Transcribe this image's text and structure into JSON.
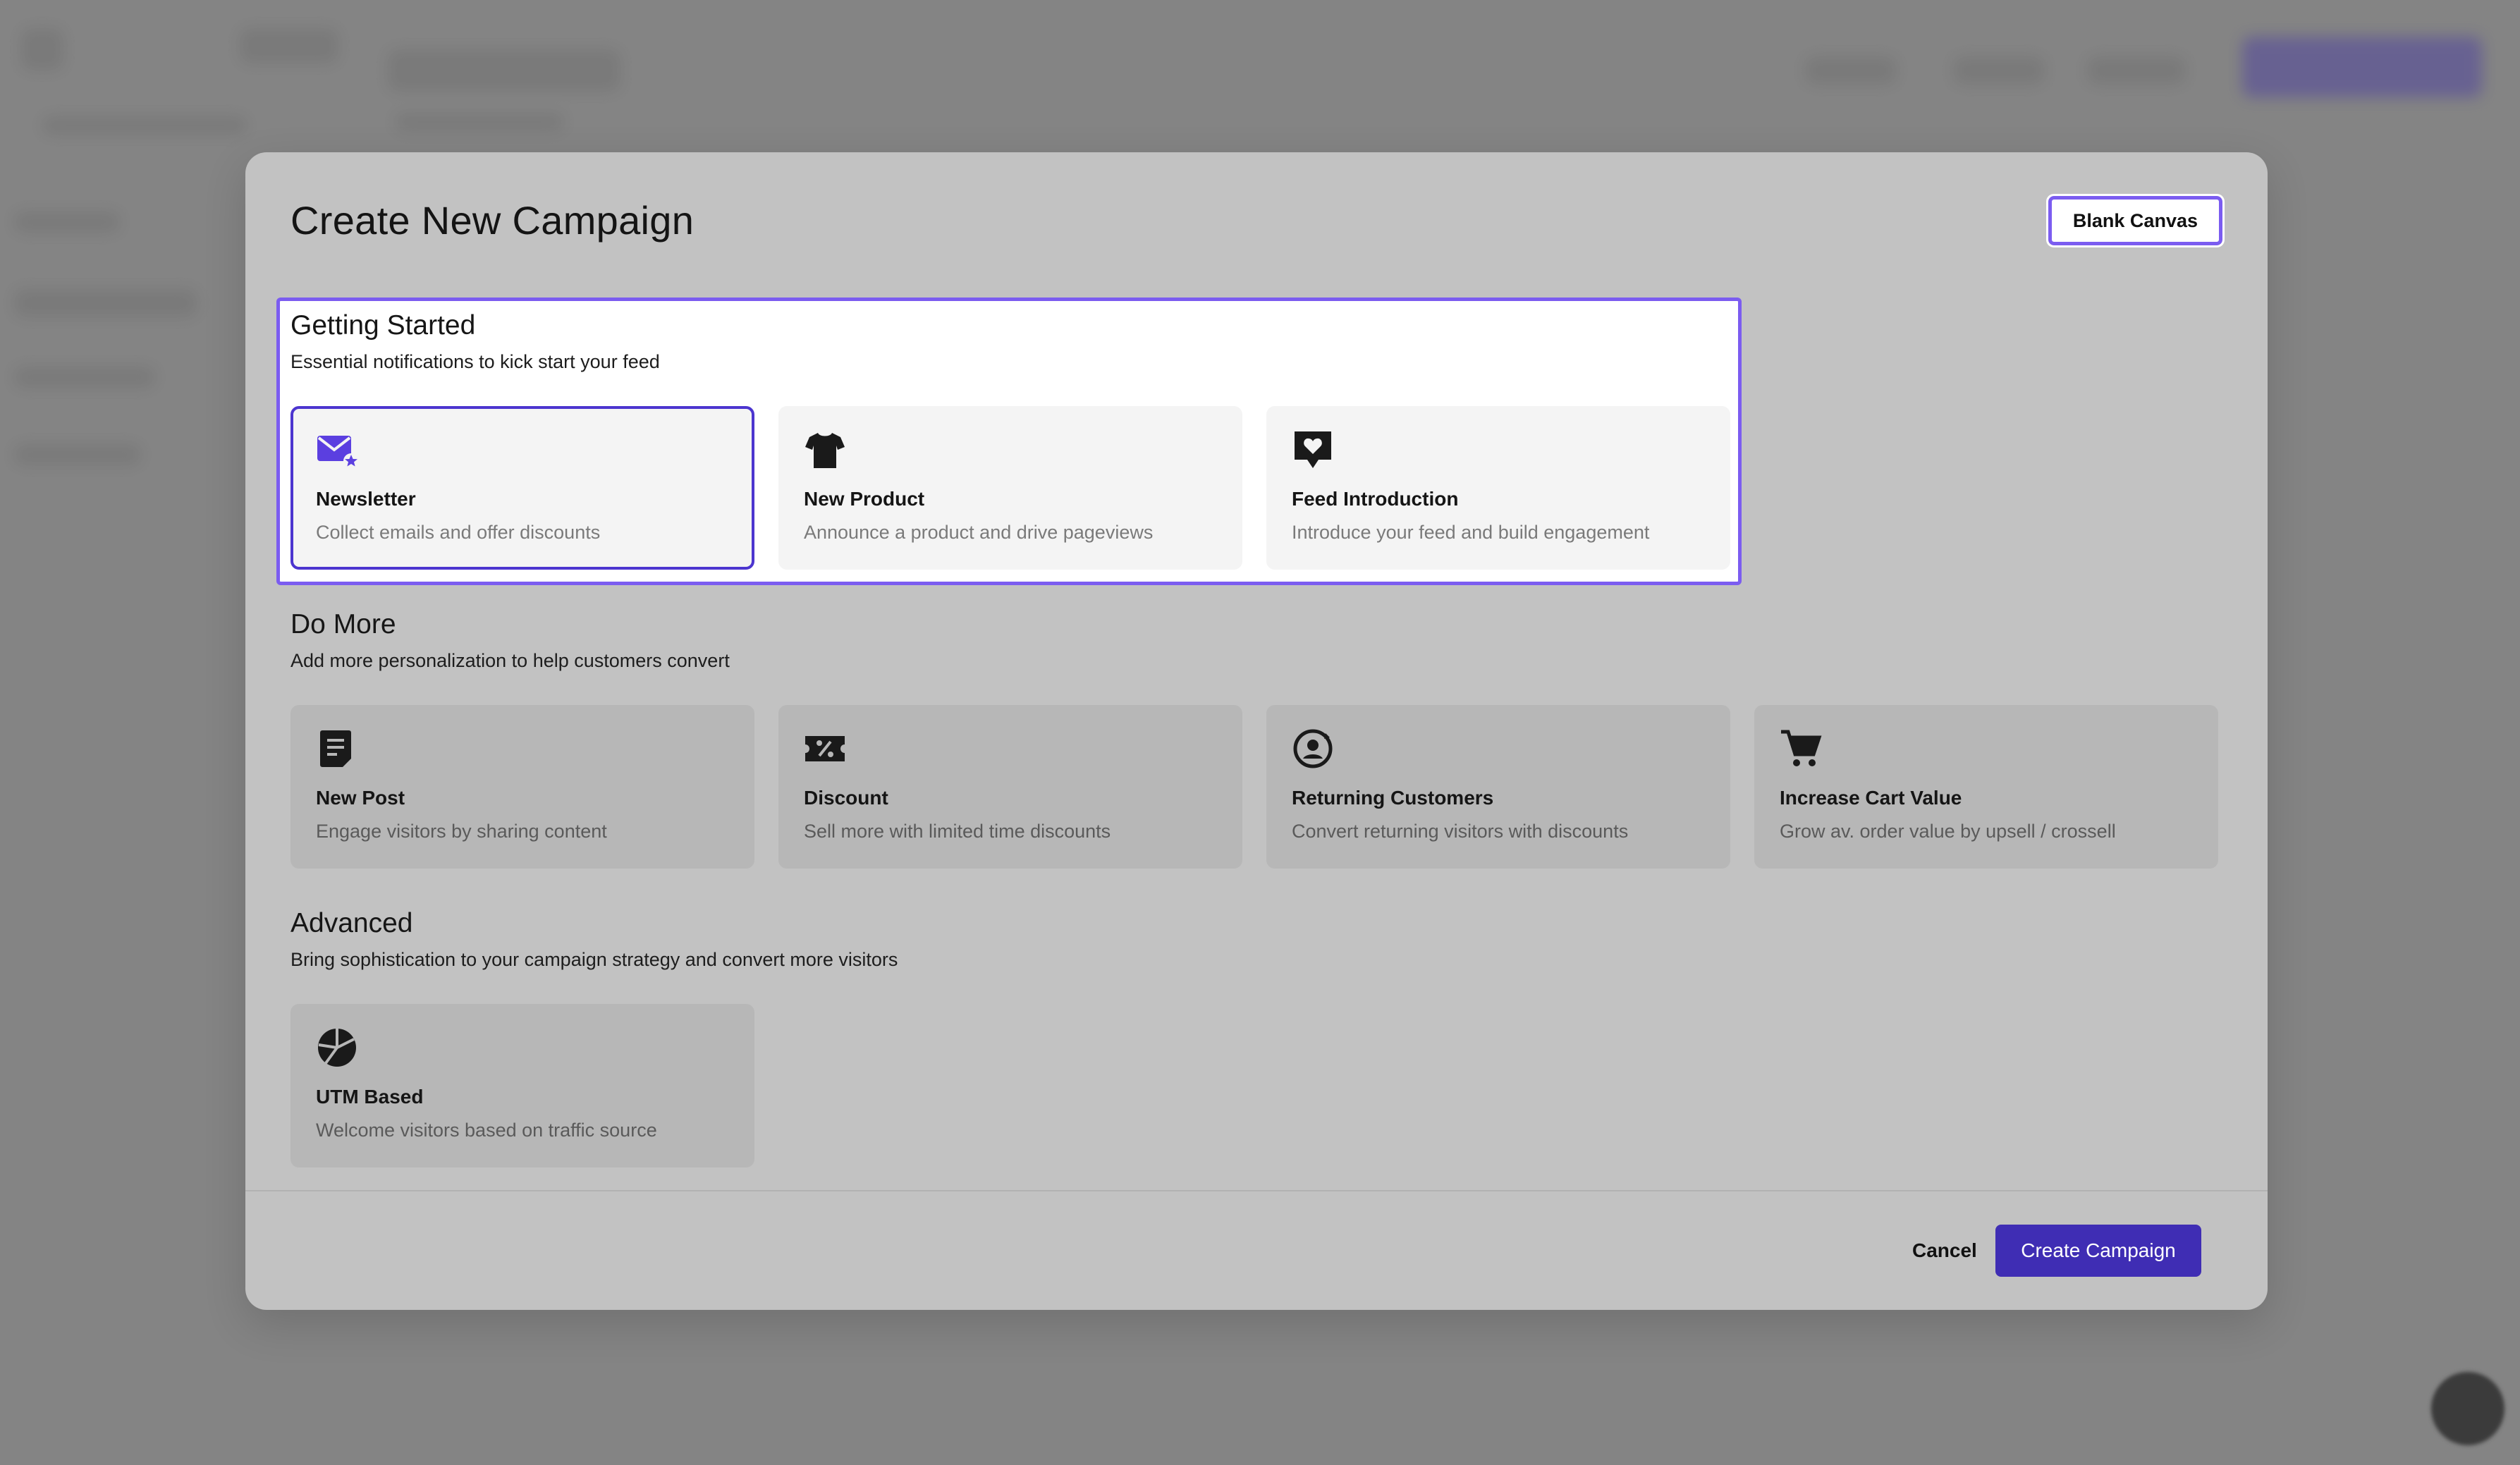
{
  "modal": {
    "title": "Create New Campaign",
    "blank_canvas_label": "Blank Canvas",
    "cancel_label": "Cancel",
    "create_label": "Create Campaign"
  },
  "sections": [
    {
      "title": "Getting Started",
      "subtitle": "Essential notifications to kick start your feed",
      "cards": [
        {
          "icon": "newsletter-icon",
          "title": "Newsletter",
          "desc": "Collect emails and offer discounts",
          "selected": true
        },
        {
          "icon": "shirt-icon",
          "title": "New Product",
          "desc": "Announce a product and drive pageviews"
        },
        {
          "icon": "heart-chat-icon",
          "title": "Feed Introduction",
          "desc": "Introduce your feed and build engagement"
        }
      ]
    },
    {
      "title": "Do More",
      "subtitle": "Add more personalization to help customers convert",
      "cards": [
        {
          "icon": "post-icon",
          "title": "New Post",
          "desc": "Engage visitors by sharing content"
        },
        {
          "icon": "discount-icon",
          "title": "Discount",
          "desc": "Sell more with limited time discounts"
        },
        {
          "icon": "returning-customer-icon",
          "title": "Returning Customers",
          "desc": "Convert returning visitors with discounts"
        },
        {
          "icon": "cart-icon",
          "title": "Increase Cart Value",
          "desc": "Grow av. order value by upsell / crossell"
        }
      ]
    },
    {
      "title": "Advanced",
      "subtitle": "Bring sophistication to your campaign strategy and convert more visitors",
      "cards": [
        {
          "icon": "utm-icon",
          "title": "UTM Based",
          "desc": "Welcome visitors based on traffic source"
        }
      ]
    }
  ],
  "colors": {
    "accent": "#3f2db4",
    "highlight_border": "#7b5cf0",
    "modal_bg": "#c2c2c2"
  }
}
